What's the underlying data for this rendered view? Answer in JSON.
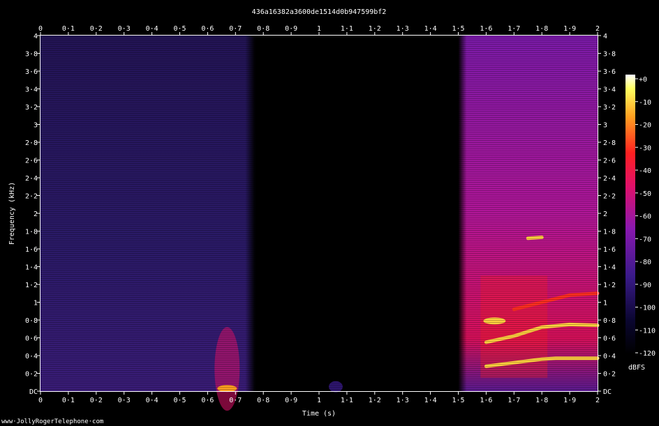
{
  "chart_data": {
    "type": "heatmap",
    "title": "436a16382a3600de1514d0b947599bf2",
    "xlabel": "Time (s)",
    "ylabel": "Frequency (kHz)",
    "xlim": [
      0,
      2
    ],
    "ylim": [
      0,
      4
    ],
    "x_ticks": [
      "0",
      "0·1",
      "0·2",
      "0·3",
      "0·4",
      "0·5",
      "0·6",
      "0·7",
      "0·8",
      "0·9",
      "1",
      "1·1",
      "1·2",
      "1·3",
      "1·4",
      "1·5",
      "1·6",
      "1·7",
      "1·8",
      "1·9",
      "2"
    ],
    "y_ticks": [
      "DC",
      "0·2",
      "0·4",
      "0·6",
      "0·8",
      "1",
      "1·2",
      "1·4",
      "1·6",
      "1·8",
      "2",
      "2·2",
      "2·4",
      "2·6",
      "2·8",
      "3",
      "3·2",
      "3·4",
      "3·6",
      "3·8",
      "4"
    ],
    "colorbar": {
      "label": "dBFS",
      "ticks": [
        "+0",
        "-10",
        "-20",
        "-30",
        "-40",
        "-50",
        "-60",
        "-70",
        "-80",
        "-90",
        "-100",
        "-110",
        "-120"
      ],
      "range": [
        -120,
        0
      ]
    },
    "segments": [
      {
        "t_start": 0.0,
        "t_end": 0.77,
        "level_dbfs": -95
      },
      {
        "t_start": 0.77,
        "t_end": 1.5,
        "level_dbfs": -120
      },
      {
        "t_start": 1.5,
        "t_end": 2.0,
        "level_dbfs": -60
      }
    ],
    "harmonics": [
      {
        "freq_khz": [
          0.28,
          0.32,
          0.36,
          0.37,
          0.37,
          0.37
        ],
        "t": [
          1.6,
          1.7,
          1.8,
          1.85,
          1.92,
          2.0
        ],
        "level_dbfs": -25
      },
      {
        "freq_khz": [
          0.55,
          0.62,
          0.72,
          0.75,
          0.74
        ],
        "t": [
          1.6,
          1.7,
          1.8,
          1.9,
          2.0
        ],
        "level_dbfs": -25
      },
      {
        "freq_khz": [
          0.92,
          1.0,
          1.08,
          1.1
        ],
        "t": [
          1.7,
          1.8,
          1.9,
          2.0
        ],
        "level_dbfs": -50
      },
      {
        "freq_khz": [
          0.79
        ],
        "t": [
          1.63
        ],
        "level_dbfs": -30
      },
      {
        "freq_khz": [
          1.72,
          1.73
        ],
        "t": [
          1.75,
          1.8
        ],
        "level_dbfs": -30
      }
    ],
    "grid": false
  },
  "watermark": "www·JollyRogerTelephone·com"
}
